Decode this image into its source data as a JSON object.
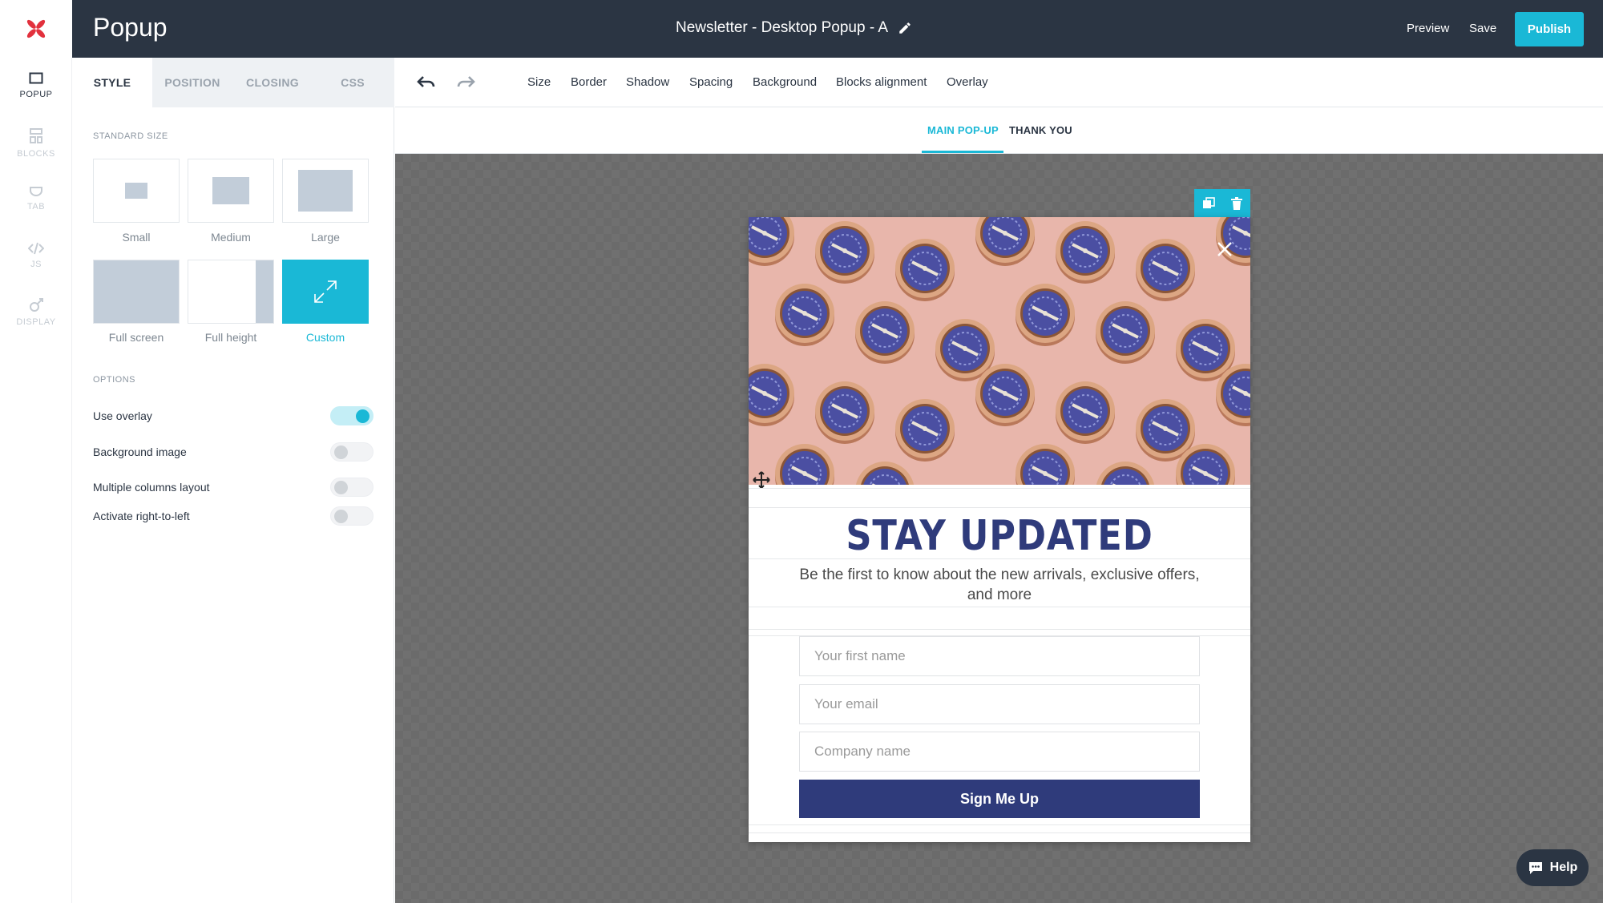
{
  "header": {
    "app_title": "Popup",
    "doc_title": "Newsletter - Desktop Popup - A",
    "preview_label": "Preview",
    "save_label": "Save",
    "publish_label": "Publish"
  },
  "rail": {
    "items": [
      {
        "label": "POPUP",
        "icon": "popup-icon"
      },
      {
        "label": "BLOCKS",
        "icon": "blocks-icon"
      },
      {
        "label": "TAB",
        "icon": "tab-icon"
      },
      {
        "label": "JS",
        "icon": "code-icon"
      },
      {
        "label": "DISPLAY",
        "icon": "display-icon"
      }
    ]
  },
  "panel": {
    "tabs": [
      "STYLE",
      "POSITION",
      "CLOSING",
      "CSS"
    ],
    "standard_size_label": "STANDARD SIZE",
    "sizes": [
      "Small",
      "Medium",
      "Large",
      "Full screen",
      "Full height",
      "Custom"
    ],
    "selected_size": "Custom",
    "options_label": "OPTIONS",
    "options": [
      {
        "label": "Use overlay",
        "on": true
      },
      {
        "label": "Background image",
        "on": false
      },
      {
        "label": "Multiple columns layout",
        "on": false
      },
      {
        "label": "Activate right-to-left",
        "on": false
      }
    ]
  },
  "toolbar": {
    "items": [
      "Size",
      "Border",
      "Shadow",
      "Spacing",
      "Background",
      "Blocks alignment",
      "Overlay"
    ]
  },
  "subtabs": {
    "main": "MAIN POP-UP",
    "thanks": "THANK YOU"
  },
  "popup": {
    "headline": "STAY UPDATED",
    "subtext": "Be the first to know about the new arrivals, exclusive offers, and more",
    "fields": [
      "Your first name",
      "Your email",
      "Company name"
    ],
    "button_label": "Sign Me Up"
  },
  "help": {
    "label": "Help"
  },
  "colors": {
    "accent": "#1ab8d6",
    "header_bg": "#2b3543",
    "popup_primary": "#2f3b7b",
    "logo_red": "#e2313d"
  }
}
